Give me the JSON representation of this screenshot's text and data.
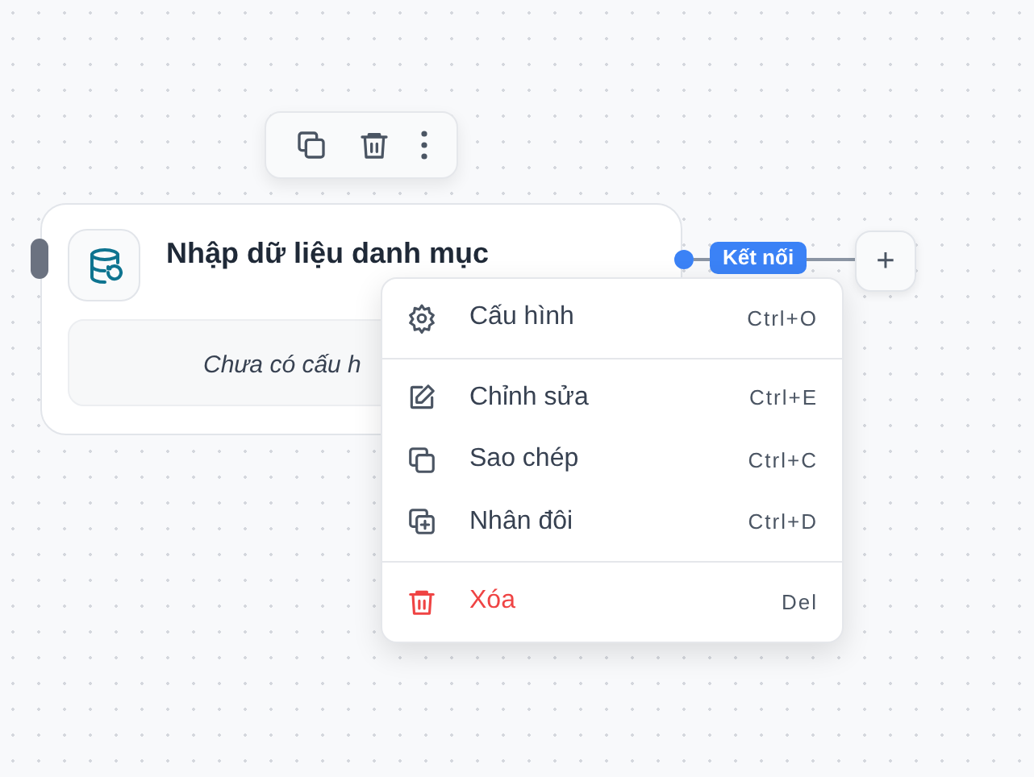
{
  "node": {
    "title": "Nhập dữ liệu danh mục",
    "description": "Chưa có cấu h"
  },
  "connection": {
    "label": "Kết nối"
  },
  "add_button": {
    "label": "+"
  },
  "context_menu": {
    "groups": [
      [
        {
          "label": "Cấu hình",
          "shortcut": "Ctrl+O",
          "kind": "normal"
        }
      ],
      [
        {
          "label": "Chỉnh sửa",
          "shortcut": "Ctrl+E",
          "kind": "normal"
        },
        {
          "label": "Sao chép",
          "shortcut": "Ctrl+C",
          "kind": "normal"
        },
        {
          "label": "Nhân đôi",
          "shortcut": "Ctrl+D",
          "kind": "normal"
        }
      ],
      [
        {
          "label": "Xóa",
          "shortcut": "Del",
          "kind": "danger"
        }
      ]
    ]
  }
}
